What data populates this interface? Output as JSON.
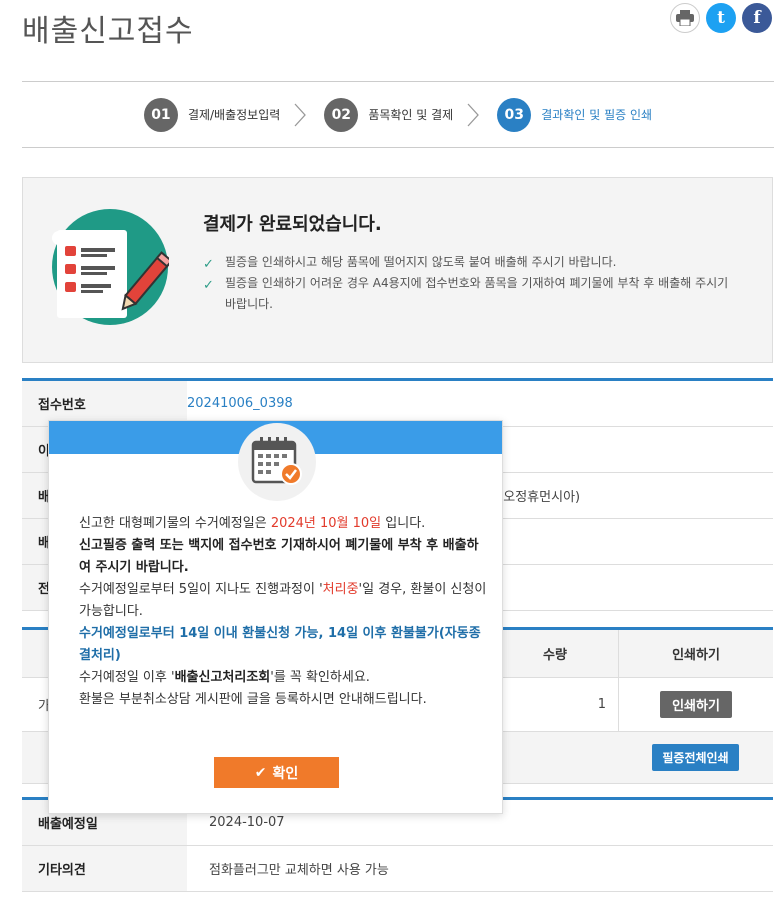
{
  "page": {
    "title": "배출신고접수"
  },
  "share": {
    "print_icon": "printer-icon",
    "twitter_icon": "twitter-icon",
    "facebook_icon": "facebook-icon",
    "twitter_glyph": "t",
    "facebook_glyph": "f"
  },
  "steps": [
    {
      "num": "01",
      "label": "결제/배출정보입력",
      "active": false
    },
    {
      "num": "02",
      "label": "품목확인 및 결제",
      "active": false
    },
    {
      "num": "03",
      "label": "결과확인 및 필증 인쇄",
      "active": true
    }
  ],
  "done": {
    "title": "결제가 완료되었습니다.",
    "items": [
      "필증을 인쇄하시고 해당 품목에 떨어지지 않도록 붙여 배출해 주시기 바랍니다.",
      "필증을 인쇄하기 어려운 경우 A4용지에 접수번호와 품목을 기재하여 폐기물에 부착 후 배출해 주시기 바랍니다."
    ]
  },
  "info_top": [
    {
      "label": "접수번호",
      "value": "20241006_0398",
      "link": true
    },
    {
      "label": "이",
      "value": "",
      "link": false
    },
    {
      "label": "배",
      "value": ". 오정휴먼시아)",
      "link": false
    },
    {
      "label": "배",
      "value": "",
      "link": false
    },
    {
      "label": "전",
      "value": "",
      "link": false
    }
  ],
  "items_table": {
    "headers": {
      "qty": "수량",
      "print": "인쇄하기"
    },
    "rows": [
      {
        "name": "가",
        "qty": "1",
        "print_label": "인쇄하기"
      }
    ],
    "print_all_label": "필증전체인쇄"
  },
  "info_bottom": [
    {
      "label": "배출예정일",
      "value": "2024-10-07"
    },
    {
      "label": "기타의견",
      "value": "점화플러그만 교체하면 사용 가능"
    }
  ],
  "modal": {
    "line1_pre": "신고한 대형폐기물의 수거예정일은 ",
    "line1_date": "2024년 10월 10일",
    "line1_post": " 입니다.",
    "line2": "신고필증 출력 또는 백지에 접수번호 기재하시어 폐기물에 부착 후 배출하여 주시기 바랍니다.",
    "line3_pre": "수거예정일로부터 5일이 지나도 진행과정이 '",
    "line3_status": "처리중",
    "line3_post": "'일 경우, 환불이 신청이 가능합니다.",
    "line4": "수거예정일로부터 14일 이내 환불신청 가능, 14일 이후 환불불가(자동종결처리)",
    "line5_pre": "수거예정일 이후 '",
    "line5_b": "배출신고처리조회",
    "line5_post": "'를 꼭 확인하세요.",
    "line6": "환불은 부분취소상담 게시판에 글을 등록하시면 안내해드립니다.",
    "confirm_label": "확인",
    "confirm_icon": "check-icon"
  },
  "colors": {
    "accent": "#2a80c4",
    "modal_bar": "#3a9ce8",
    "confirm": "#f07a2a",
    "date_red": "#e23a2b"
  }
}
